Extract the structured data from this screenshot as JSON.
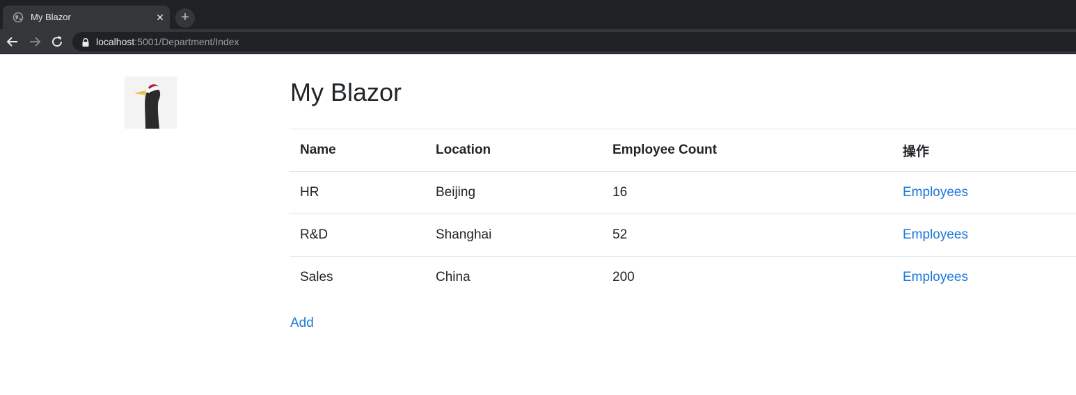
{
  "browser": {
    "tab_title": "My Blazor",
    "tab_close": "✕",
    "new_tab": "+",
    "url_host": "localhost",
    "url_rest": ":5001/Department/Index"
  },
  "page": {
    "title": "My Blazor",
    "table": {
      "headers": [
        "Name",
        "Location",
        "Employee Count",
        "操作"
      ],
      "rows": [
        {
          "name": "HR",
          "location": "Beijing",
          "count": "16",
          "action": "Employees"
        },
        {
          "name": "R&D",
          "location": "Shanghai",
          "count": "52",
          "action": "Employees"
        },
        {
          "name": "Sales",
          "location": "China",
          "count": "200",
          "action": "Employees"
        }
      ]
    },
    "add_label": "Add"
  },
  "colors": {
    "link": "#1b78d8",
    "text": "#212529",
    "chrome_dark": "#202124",
    "chrome_tab": "#35363a"
  },
  "icons": [
    "globe-icon",
    "close-icon",
    "plus-icon",
    "back-arrow-icon",
    "forward-arrow-icon",
    "reload-icon",
    "lock-icon",
    "crane-logo"
  ]
}
